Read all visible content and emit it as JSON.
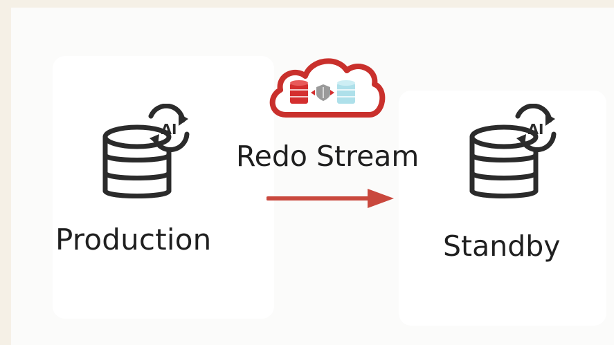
{
  "diagram": {
    "source": {
      "label": "Production",
      "icon": "database-ai-sync-icon",
      "badge_text": "AI"
    },
    "link": {
      "label": "Redo Stream",
      "icon": "cloud-replication-icon",
      "arrow_icon": "arrow-right-icon",
      "arrow_color": "#c9483d"
    },
    "target": {
      "label": "Standby",
      "icon": "database-ai-sync-icon",
      "badge_text": "AI"
    },
    "colors": {
      "icon_stroke": "#2b2b2b",
      "cloud_stroke": "#c9302c",
      "db_red": "#d42f2f",
      "db_light": "#aee0ea",
      "background": "#f5f0e6"
    }
  }
}
